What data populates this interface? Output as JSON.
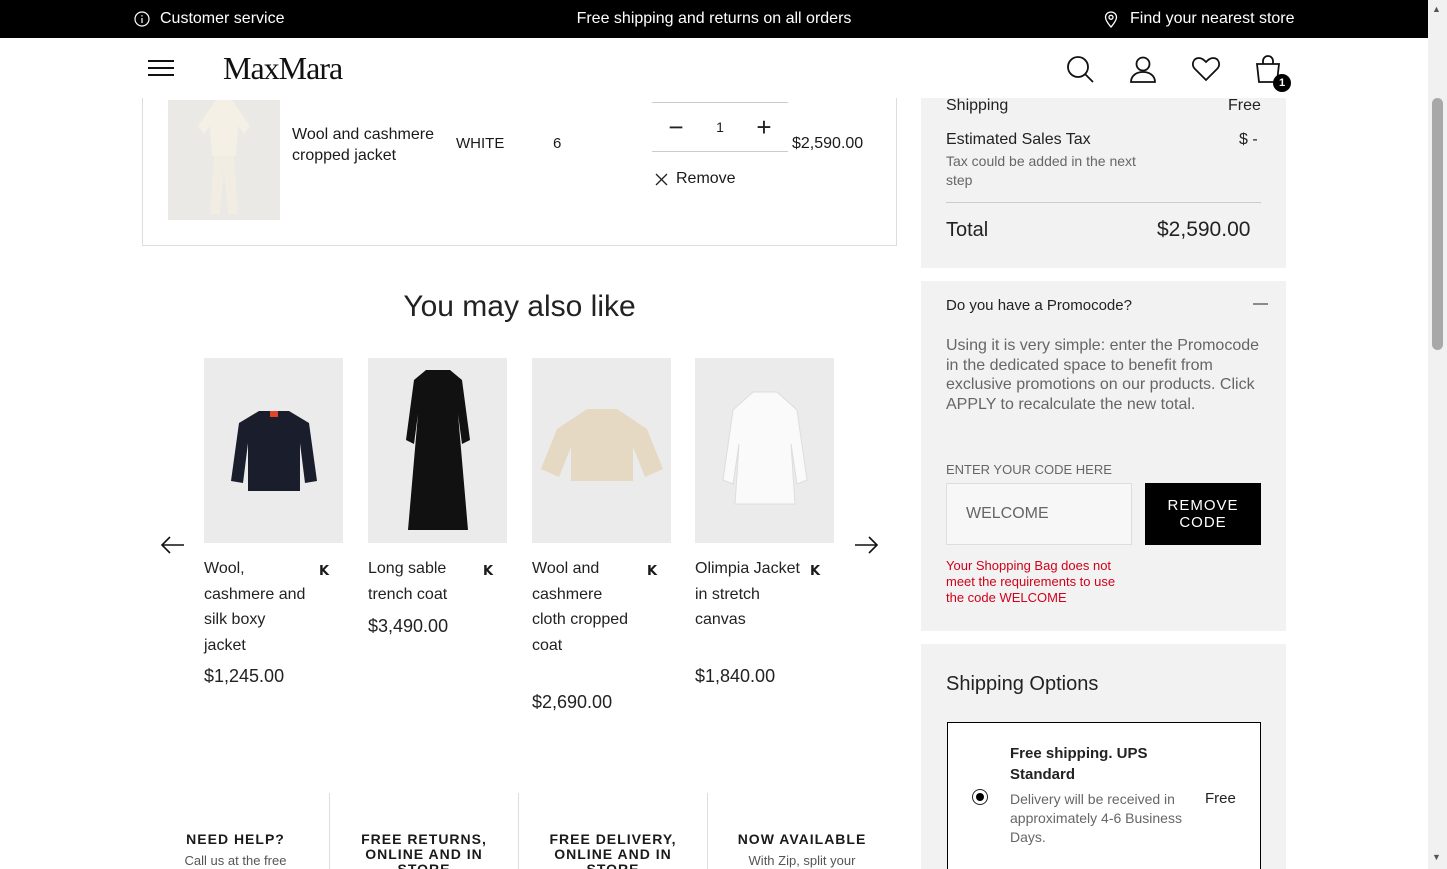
{
  "topbar": {
    "customer_service": "Customer service",
    "shipping_message": "Free shipping and returns on all orders",
    "store_locator": "Find your nearest store"
  },
  "header": {
    "logo": "MaxMara",
    "bag_count": "1"
  },
  "cart_item": {
    "name": "Wool and cashmere cropped jacket",
    "color": "WHITE",
    "size": "6",
    "quantity": "1",
    "price": "$2,590.00",
    "remove_label": "Remove"
  },
  "recommendations": {
    "title": "You may also like",
    "items": [
      {
        "name": "Wool, cashmere and silk boxy jacket",
        "price": "$1,245.00"
      },
      {
        "name": "Long sable trench coat",
        "price": "$3,490.00"
      },
      {
        "name": "Wool and cashmere cloth cropped coat",
        "price": "$2,690.00"
      },
      {
        "name": "Olimpia Jacket in stretch canvas",
        "price": "$1,840.00"
      }
    ]
  },
  "features": [
    {
      "title": "NEED HELP?",
      "sub": "Call us at the free"
    },
    {
      "title": "FREE RETURNS, ONLINE AND IN STORE",
      "sub": ""
    },
    {
      "title": "FREE DELIVERY, ONLINE AND IN STORE",
      "sub": ""
    },
    {
      "title": "NOW AVAILABLE",
      "sub": "With Zip, split your"
    }
  ],
  "summary": {
    "shipping_label": "Shipping",
    "shipping_value": "Free",
    "tax_label": "Estimated Sales Tax",
    "tax_value": "$ -",
    "tax_note": "Tax could be added in the next step",
    "total_label": "Total",
    "total_value": "$2,590.00"
  },
  "promo": {
    "title": "Do you have a Promocode?",
    "collapse_symbol": "—",
    "description": "Using it is very simple: enter the Promocode in the dedicated space to benefit from exclusive promotions on our products. Click APPLY to recalculate the new total.",
    "input_label": "ENTER YOUR CODE HERE",
    "input_value": "WELCOME",
    "button_label": "REMOVE CODE",
    "error": "Your Shopping Bag does not meet the requirements to use the code WELCOME"
  },
  "shipping_options": {
    "title": "Shipping Options",
    "option_name": "Free shipping. UPS Standard",
    "option_desc": "Delivery will be received in approximately 4-6 Business Days.",
    "option_price": "Free"
  },
  "colors": {
    "accent": "#000000",
    "error": "#d0021b",
    "panel": "#f2f2f2"
  }
}
